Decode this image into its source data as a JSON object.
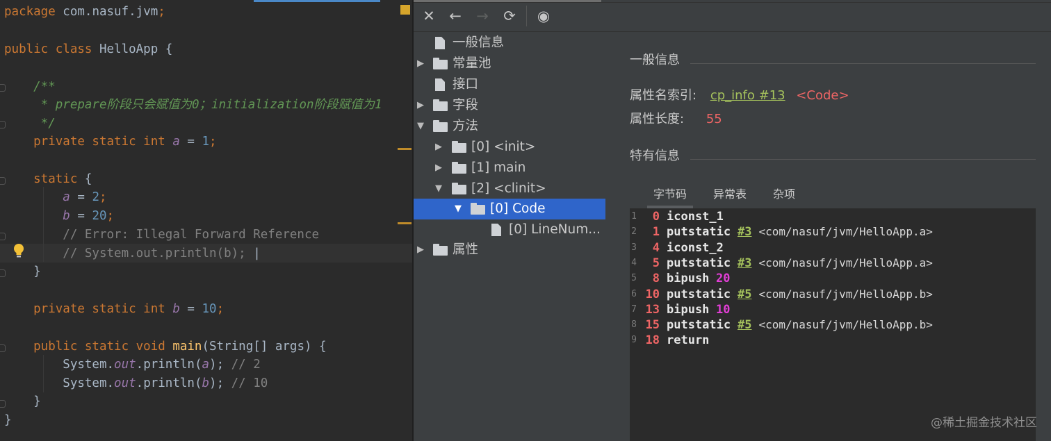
{
  "editor": {
    "lines": [
      {
        "tokens": [
          {
            "t": "package ",
            "c": "kw"
          },
          {
            "t": "com.nasuf.jvm",
            "c": ""
          },
          {
            "t": ";",
            "c": "kw"
          }
        ]
      },
      {
        "tokens": [
          {
            "t": "public class ",
            "c": "kw"
          },
          {
            "t": "HelloApp {",
            "c": ""
          }
        ]
      },
      {
        "tokens": [
          {
            "t": "    /**",
            "c": "cmt"
          }
        ]
      },
      {
        "tokens": [
          {
            "t": "     * prepare阶段只会赋值为0；initialization阶段赋值为1",
            "c": "cmt"
          }
        ]
      },
      {
        "tokens": [
          {
            "t": "     */",
            "c": "cmt"
          }
        ]
      },
      {
        "tokens": [
          {
            "t": "    private static int ",
            "c": "kw"
          },
          {
            "t": "a",
            "c": "fld"
          },
          {
            "t": " = ",
            "c": ""
          },
          {
            "t": "1",
            "c": "num"
          },
          {
            "t": ";",
            "c": "kw"
          }
        ]
      },
      {
        "tokens": [
          {
            "t": "    static ",
            "c": "kw"
          },
          {
            "t": "{",
            "c": ""
          }
        ]
      },
      {
        "tokens": [
          {
            "t": "        ",
            "c": ""
          },
          {
            "t": "a",
            "c": "fld"
          },
          {
            "t": " = ",
            "c": ""
          },
          {
            "t": "2",
            "c": "num"
          },
          {
            "t": ";",
            "c": "kw"
          }
        ]
      },
      {
        "tokens": [
          {
            "t": "        ",
            "c": ""
          },
          {
            "t": "b",
            "c": "fld"
          },
          {
            "t": " = ",
            "c": ""
          },
          {
            "t": "20",
            "c": "num"
          },
          {
            "t": ";",
            "c": "kw"
          }
        ]
      },
      {
        "tokens": [
          {
            "t": "        // Error: Illegal Forward Reference",
            "c": "lc"
          }
        ]
      },
      {
        "tokens": [
          {
            "t": "        // System.out.println(b); ",
            "c": "lc"
          },
          {
            "t": "|",
            "c": ""
          }
        ]
      },
      {
        "tokens": [
          {
            "t": "    }",
            "c": ""
          }
        ]
      },
      {
        "tokens": [
          {
            "t": "    private static int ",
            "c": "kw"
          },
          {
            "t": "b",
            "c": "fld"
          },
          {
            "t": " = ",
            "c": ""
          },
          {
            "t": "10",
            "c": "num"
          },
          {
            "t": ";",
            "c": "kw"
          }
        ]
      },
      {
        "tokens": [
          {
            "t": "    public static void ",
            "c": "kw"
          },
          {
            "t": "main",
            "c": "fn"
          },
          {
            "t": "(String[] args) {",
            "c": ""
          }
        ]
      },
      {
        "tokens": [
          {
            "t": "        System.",
            "c": ""
          },
          {
            "t": "out",
            "c": "fld"
          },
          {
            "t": ".println(",
            "c": ""
          },
          {
            "t": "a",
            "c": "fld"
          },
          {
            "t": "); ",
            "c": ""
          },
          {
            "t": "// 2",
            "c": "lc"
          }
        ]
      },
      {
        "tokens": [
          {
            "t": "        System.",
            "c": ""
          },
          {
            "t": "out",
            "c": "fld"
          },
          {
            "t": ".println(",
            "c": ""
          },
          {
            "t": "b",
            "c": "fld"
          },
          {
            "t": "); ",
            "c": ""
          },
          {
            "t": "// 10",
            "c": "lc"
          }
        ]
      },
      {
        "tokens": [
          {
            "t": "    }",
            "c": ""
          }
        ]
      },
      {
        "tokens": [
          {
            "t": "}",
            "c": ""
          }
        ]
      }
    ]
  },
  "toolbar": {
    "close_icon": "✕",
    "back_icon": "←",
    "forward_icon": "→",
    "refresh_icon": "⟳",
    "web_icon": "◉"
  },
  "tree": {
    "general": "一般信息",
    "constant_pool": "常量池",
    "interfaces": "接口",
    "fields": "字段",
    "methods": "方法",
    "method_init": "[0] <init>",
    "method_main": "[1] main",
    "method_clinit": "[2] <clinit>",
    "code": "[0] Code",
    "line_number": "[0] LineNum...",
    "attributes": "属性"
  },
  "details": {
    "general_title": "一般信息",
    "name_index_label": "属性名索引:",
    "name_index_link": "cp_info #13",
    "name_index_value": "<Code>",
    "length_label": "属性长度:",
    "length_value": "55",
    "specific_title": "特有信息",
    "tabs": [
      "字节码",
      "异常表",
      "杂项"
    ]
  },
  "bytecode": [
    {
      "n": "1",
      "off": "0",
      "op": "iconst_1",
      "ref": "",
      "imm": "",
      "cmt": ""
    },
    {
      "n": "2",
      "off": "1",
      "op": "putstatic",
      "ref": "#3",
      "imm": "",
      "cmt": "<com/nasuf/jvm/HelloApp.a>"
    },
    {
      "n": "3",
      "off": "4",
      "op": "iconst_2",
      "ref": "",
      "imm": "",
      "cmt": ""
    },
    {
      "n": "4",
      "off": "5",
      "op": "putstatic",
      "ref": "#3",
      "imm": "",
      "cmt": "<com/nasuf/jvm/HelloApp.a>"
    },
    {
      "n": "5",
      "off": "8",
      "op": "bipush",
      "ref": "",
      "imm": "20",
      "cmt": ""
    },
    {
      "n": "6",
      "off": "10",
      "op": "putstatic",
      "ref": "#5",
      "imm": "",
      "cmt": "<com/nasuf/jvm/HelloApp.b>"
    },
    {
      "n": "7",
      "off": "13",
      "op": "bipush",
      "ref": "",
      "imm": "10",
      "cmt": ""
    },
    {
      "n": "8",
      "off": "15",
      "op": "putstatic",
      "ref": "#5",
      "imm": "",
      "cmt": "<com/nasuf/jvm/HelloApp.b>"
    },
    {
      "n": "9",
      "off": "18",
      "op": "return",
      "ref": "",
      "imm": "",
      "cmt": ""
    }
  ],
  "watermark": "@稀土掘金技术社区"
}
